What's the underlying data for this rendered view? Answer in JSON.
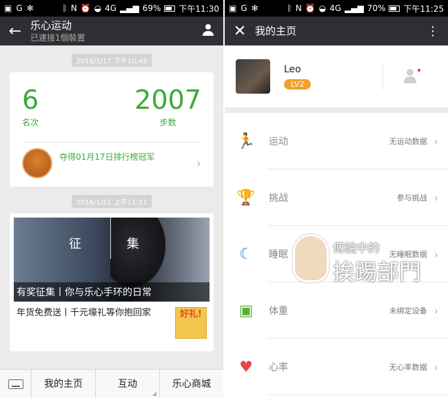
{
  "left": {
    "status": {
      "percent": "69%",
      "time": "下午11:30",
      "net": "4G"
    },
    "toolbar": {
      "title": "乐心运动",
      "subtitle": "已連接1個裝置"
    },
    "msg1": {
      "time": "2016/1/17 下午10:45",
      "rank_value": "6",
      "rank_label": "名次",
      "steps_value": "2007",
      "steps_label": "步数",
      "champ_text": "夺得01月17日排行榜冠军"
    },
    "msg2": {
      "time": "2016/1/21 上午11:21",
      "banner_text": "征 集",
      "banner_caption": "有奖征集丨你与乐心手环的日常",
      "news_title": "年货免费送丨千元壕礼等你抱回家",
      "thumb_text": "好礼!"
    },
    "bottom": {
      "item1": "我的主页",
      "item2": "互动",
      "item3": "乐心商城"
    }
  },
  "right": {
    "status": {
      "percent": "70%",
      "time": "下午11:25",
      "net": "4G"
    },
    "toolbar": {
      "title": "我的主页"
    },
    "profile": {
      "name": "Leo",
      "level": "LV2"
    },
    "menu": [
      {
        "label": "运动",
        "value": "无运动数据",
        "icon": "running-icon",
        "color": "#f08a24"
      },
      {
        "label": "挑战",
        "value": "参与挑战",
        "icon": "trophy-icon",
        "color": "#f0a12d"
      },
      {
        "label": "睡眠",
        "value": "无睡眠数据",
        "icon": "sleep-moon-icon",
        "color": "#1f7fd0"
      },
      {
        "label": "体重",
        "value": "未绑定设备",
        "icon": "scale-icon",
        "color": "#59b13c"
      },
      {
        "label": "心率",
        "value": "无心率数据",
        "icon": "heart-rate-icon",
        "color": "#e44a4a"
      }
    ]
  },
  "watermark": {
    "line1": "傳說中的",
    "line2": "挨踢部門"
  }
}
